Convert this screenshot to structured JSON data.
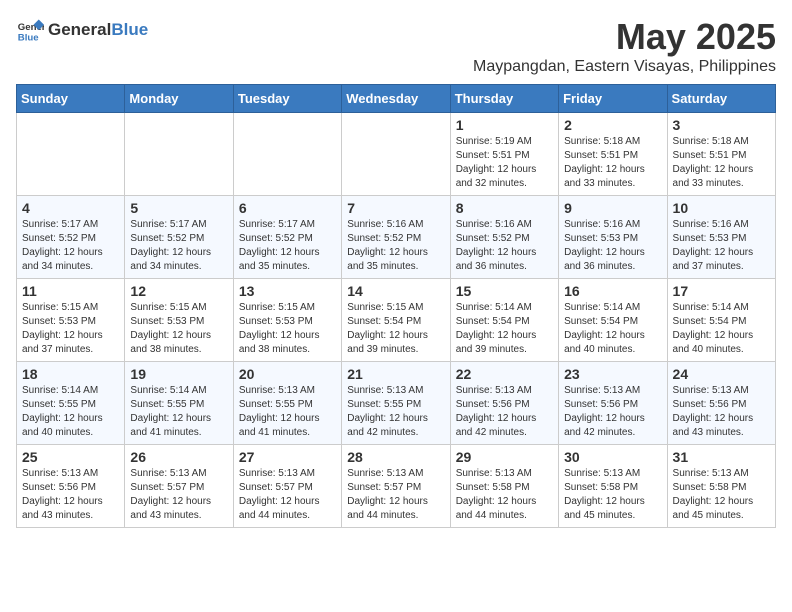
{
  "logo": {
    "general": "General",
    "blue": "Blue"
  },
  "title": "May 2025",
  "subtitle": "Maypangdan, Eastern Visayas, Philippines",
  "headers": [
    "Sunday",
    "Monday",
    "Tuesday",
    "Wednesday",
    "Thursday",
    "Friday",
    "Saturday"
  ],
  "weeks": [
    [
      {
        "day": "",
        "info": ""
      },
      {
        "day": "",
        "info": ""
      },
      {
        "day": "",
        "info": ""
      },
      {
        "day": "",
        "info": ""
      },
      {
        "day": "1",
        "info": "Sunrise: 5:19 AM\nSunset: 5:51 PM\nDaylight: 12 hours\nand 32 minutes."
      },
      {
        "day": "2",
        "info": "Sunrise: 5:18 AM\nSunset: 5:51 PM\nDaylight: 12 hours\nand 33 minutes."
      },
      {
        "day": "3",
        "info": "Sunrise: 5:18 AM\nSunset: 5:51 PM\nDaylight: 12 hours\nand 33 minutes."
      }
    ],
    [
      {
        "day": "4",
        "info": "Sunrise: 5:17 AM\nSunset: 5:52 PM\nDaylight: 12 hours\nand 34 minutes."
      },
      {
        "day": "5",
        "info": "Sunrise: 5:17 AM\nSunset: 5:52 PM\nDaylight: 12 hours\nand 34 minutes."
      },
      {
        "day": "6",
        "info": "Sunrise: 5:17 AM\nSunset: 5:52 PM\nDaylight: 12 hours\nand 35 minutes."
      },
      {
        "day": "7",
        "info": "Sunrise: 5:16 AM\nSunset: 5:52 PM\nDaylight: 12 hours\nand 35 minutes."
      },
      {
        "day": "8",
        "info": "Sunrise: 5:16 AM\nSunset: 5:52 PM\nDaylight: 12 hours\nand 36 minutes."
      },
      {
        "day": "9",
        "info": "Sunrise: 5:16 AM\nSunset: 5:53 PM\nDaylight: 12 hours\nand 36 minutes."
      },
      {
        "day": "10",
        "info": "Sunrise: 5:16 AM\nSunset: 5:53 PM\nDaylight: 12 hours\nand 37 minutes."
      }
    ],
    [
      {
        "day": "11",
        "info": "Sunrise: 5:15 AM\nSunset: 5:53 PM\nDaylight: 12 hours\nand 37 minutes."
      },
      {
        "day": "12",
        "info": "Sunrise: 5:15 AM\nSunset: 5:53 PM\nDaylight: 12 hours\nand 38 minutes."
      },
      {
        "day": "13",
        "info": "Sunrise: 5:15 AM\nSunset: 5:53 PM\nDaylight: 12 hours\nand 38 minutes."
      },
      {
        "day": "14",
        "info": "Sunrise: 5:15 AM\nSunset: 5:54 PM\nDaylight: 12 hours\nand 39 minutes."
      },
      {
        "day": "15",
        "info": "Sunrise: 5:14 AM\nSunset: 5:54 PM\nDaylight: 12 hours\nand 39 minutes."
      },
      {
        "day": "16",
        "info": "Sunrise: 5:14 AM\nSunset: 5:54 PM\nDaylight: 12 hours\nand 40 minutes."
      },
      {
        "day": "17",
        "info": "Sunrise: 5:14 AM\nSunset: 5:54 PM\nDaylight: 12 hours\nand 40 minutes."
      }
    ],
    [
      {
        "day": "18",
        "info": "Sunrise: 5:14 AM\nSunset: 5:55 PM\nDaylight: 12 hours\nand 40 minutes."
      },
      {
        "day": "19",
        "info": "Sunrise: 5:14 AM\nSunset: 5:55 PM\nDaylight: 12 hours\nand 41 minutes."
      },
      {
        "day": "20",
        "info": "Sunrise: 5:13 AM\nSunset: 5:55 PM\nDaylight: 12 hours\nand 41 minutes."
      },
      {
        "day": "21",
        "info": "Sunrise: 5:13 AM\nSunset: 5:55 PM\nDaylight: 12 hours\nand 42 minutes."
      },
      {
        "day": "22",
        "info": "Sunrise: 5:13 AM\nSunset: 5:56 PM\nDaylight: 12 hours\nand 42 minutes."
      },
      {
        "day": "23",
        "info": "Sunrise: 5:13 AM\nSunset: 5:56 PM\nDaylight: 12 hours\nand 42 minutes."
      },
      {
        "day": "24",
        "info": "Sunrise: 5:13 AM\nSunset: 5:56 PM\nDaylight: 12 hours\nand 43 minutes."
      }
    ],
    [
      {
        "day": "25",
        "info": "Sunrise: 5:13 AM\nSunset: 5:56 PM\nDaylight: 12 hours\nand 43 minutes."
      },
      {
        "day": "26",
        "info": "Sunrise: 5:13 AM\nSunset: 5:57 PM\nDaylight: 12 hours\nand 43 minutes."
      },
      {
        "day": "27",
        "info": "Sunrise: 5:13 AM\nSunset: 5:57 PM\nDaylight: 12 hours\nand 44 minutes."
      },
      {
        "day": "28",
        "info": "Sunrise: 5:13 AM\nSunset: 5:57 PM\nDaylight: 12 hours\nand 44 minutes."
      },
      {
        "day": "29",
        "info": "Sunrise: 5:13 AM\nSunset: 5:58 PM\nDaylight: 12 hours\nand 44 minutes."
      },
      {
        "day": "30",
        "info": "Sunrise: 5:13 AM\nSunset: 5:58 PM\nDaylight: 12 hours\nand 45 minutes."
      },
      {
        "day": "31",
        "info": "Sunrise: 5:13 AM\nSunset: 5:58 PM\nDaylight: 12 hours\nand 45 minutes."
      }
    ]
  ]
}
